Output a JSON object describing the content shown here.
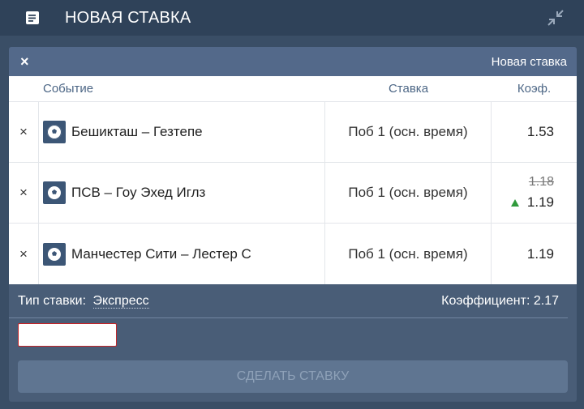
{
  "header": {
    "title": "НОВАЯ СТАВКА",
    "doc_icon": "document-icon",
    "collapse_icon": "collapse-icon"
  },
  "panel": {
    "close": "×",
    "title": "Новая ставка"
  },
  "table": {
    "columns": {
      "event": "Событие",
      "stake": "Ставка",
      "coef": "Коэф."
    },
    "rows": [
      {
        "remove": "×",
        "event": "Бешикташ – Гезтепе",
        "stake": "Поб 1 (осн. время)",
        "coef": "1.53",
        "old_coef": ""
      },
      {
        "remove": "×",
        "event": "ПСВ – Гоу Эхед Иглз",
        "stake": "Поб 1 (осн. время)",
        "coef": "1.19",
        "old_coef": "1.18",
        "trend": "up"
      },
      {
        "remove": "×",
        "event": "Манчестер Сити – Лестер С",
        "stake": "Поб 1 (осн. время)",
        "coef": "1.19",
        "old_coef": ""
      }
    ]
  },
  "summary": {
    "type_label": "Тип ставки:",
    "type_value": "Экспресс",
    "coef_label": "Коэффициент: 2.17"
  },
  "amount": {
    "value": ""
  },
  "submit": {
    "label": "СДЕЛАТЬ СТАВКУ"
  },
  "colors": {
    "header_bg": "#2f4259",
    "panel_bg": "#495d77",
    "up_arrow": "#2f9a3b",
    "input_border": "#c0262a"
  }
}
